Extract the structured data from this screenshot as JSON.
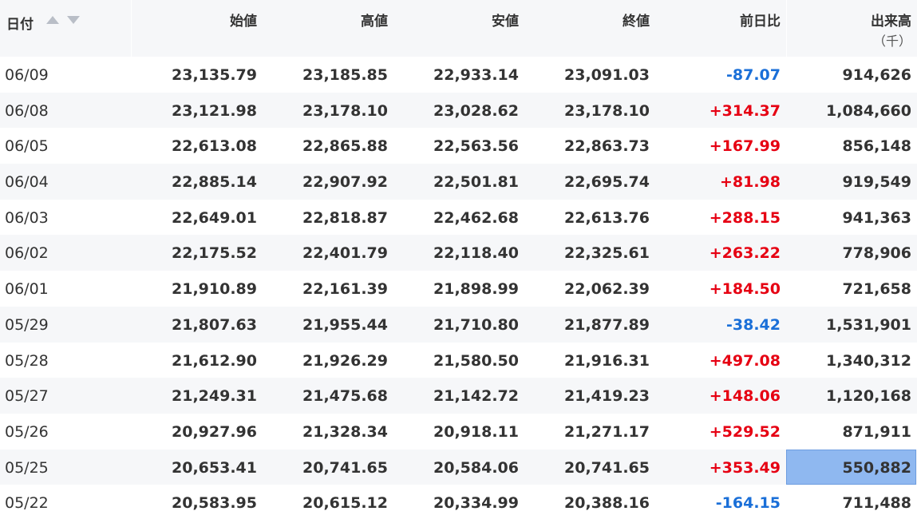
{
  "header": {
    "date": "日付",
    "open": "始値",
    "high": "高値",
    "low": "安値",
    "close": "終値",
    "change": "前日比",
    "volume": "出来高",
    "volume_unit": "（千）"
  },
  "colors": {
    "positive": "#e60012",
    "negative": "#1a6fd8",
    "selected": "#8fb8f0"
  },
  "rows": [
    {
      "date": "06/09",
      "open": "23,135.79",
      "high": "23,185.85",
      "low": "22,933.14",
      "close": "23,091.03",
      "change": "-87.07",
      "volume": "914,626"
    },
    {
      "date": "06/08",
      "open": "23,121.98",
      "high": "23,178.10",
      "low": "23,028.62",
      "close": "23,178.10",
      "change": "+314.37",
      "volume": "1,084,660"
    },
    {
      "date": "06/05",
      "open": "22,613.08",
      "high": "22,865.88",
      "low": "22,563.56",
      "close": "22,863.73",
      "change": "+167.99",
      "volume": "856,148"
    },
    {
      "date": "06/04",
      "open": "22,885.14",
      "high": "22,907.92",
      "low": "22,501.81",
      "close": "22,695.74",
      "change": "+81.98",
      "volume": "919,549"
    },
    {
      "date": "06/03",
      "open": "22,649.01",
      "high": "22,818.87",
      "low": "22,462.68",
      "close": "22,613.76",
      "change": "+288.15",
      "volume": "941,363"
    },
    {
      "date": "06/02",
      "open": "22,175.52",
      "high": "22,401.79",
      "low": "22,118.40",
      "close": "22,325.61",
      "change": "+263.22",
      "volume": "778,906"
    },
    {
      "date": "06/01",
      "open": "21,910.89",
      "high": "22,161.39",
      "low": "21,898.99",
      "close": "22,062.39",
      "change": "+184.50",
      "volume": "721,658"
    },
    {
      "date": "05/29",
      "open": "21,807.63",
      "high": "21,955.44",
      "low": "21,710.80",
      "close": "21,877.89",
      "change": "-38.42",
      "volume": "1,531,901"
    },
    {
      "date": "05/28",
      "open": "21,612.90",
      "high": "21,926.29",
      "low": "21,580.50",
      "close": "21,916.31",
      "change": "+497.08",
      "volume": "1,340,312"
    },
    {
      "date": "05/27",
      "open": "21,249.31",
      "high": "21,475.68",
      "low": "21,142.72",
      "close": "21,419.23",
      "change": "+148.06",
      "volume": "1,120,168"
    },
    {
      "date": "05/26",
      "open": "20,927.96",
      "high": "21,328.34",
      "low": "20,918.11",
      "close": "21,271.17",
      "change": "+529.52",
      "volume": "871,911"
    },
    {
      "date": "05/25",
      "open": "20,653.41",
      "high": "20,741.65",
      "low": "20,584.06",
      "close": "20,741.65",
      "change": "+353.49",
      "volume": "550,882",
      "selected_volume": true
    },
    {
      "date": "05/22",
      "open": "20,583.95",
      "high": "20,615.12",
      "low": "20,334.99",
      "close": "20,388.16",
      "change": "-164.15",
      "volume": "711,488"
    }
  ]
}
